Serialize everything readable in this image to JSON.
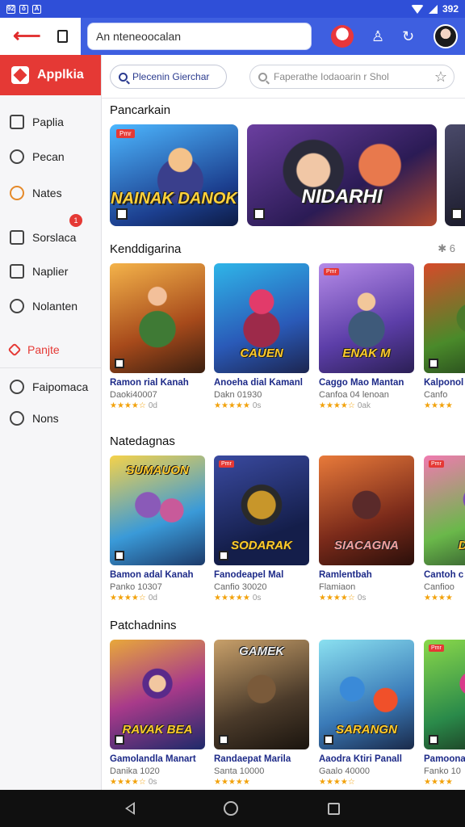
{
  "status": {
    "time": "392",
    "icons": [
      "92",
      "ō",
      "A"
    ]
  },
  "toolbar": {
    "address": "An nteneoocalan"
  },
  "sidebar": {
    "brand": "Applkia",
    "badge": "1",
    "items": [
      {
        "label": "Paplia",
        "icon": "document-icon"
      },
      {
        "label": "Pecan",
        "icon": "people-icon"
      },
      {
        "label": "Nates",
        "icon": "orange-circle-icon"
      },
      {
        "label": "Sorslaca",
        "icon": "list-icon"
      },
      {
        "label": "Naplier",
        "icon": "grid-icon"
      },
      {
        "label": "Nolanten",
        "icon": "clock-icon"
      },
      {
        "label": "Panjte",
        "icon": "diamond-icon",
        "active": true
      },
      {
        "label": "Faipomaca",
        "icon": "time-icon"
      },
      {
        "label": "Nons",
        "icon": "shield-icon"
      }
    ]
  },
  "filters": {
    "chip": "Plecenin Gierchar",
    "search_placeholder": "Faperathe Iodaoarin r Shol"
  },
  "sections": [
    {
      "title": "Pancarkain",
      "banners": [
        {
          "title": "NAINAK DANOK",
          "tag": "Pmr"
        },
        {
          "title": "NIDARHI",
          "tag": ""
        }
      ]
    },
    {
      "title": "Kenddigarina",
      "more": "✱ 6",
      "cards": [
        {
          "art": "",
          "title": "Ramon rial Kanah",
          "sub": "Daoki40007",
          "stars": "★★★★☆",
          "count": "0d"
        },
        {
          "art": "CAUEN",
          "title": "Anoeha dial Kamanl",
          "sub": "Dakn 01930",
          "stars": "★★★★★",
          "count": "0s"
        },
        {
          "art": "ENAK M",
          "title": "Caggo Mao Mantan",
          "sub": "Canfoa 04 lenoan",
          "stars": "★★★★☆",
          "count": "0ak"
        },
        {
          "art": "",
          "title": "Kalponol",
          "sub": "Canfo",
          "stars": "★★★★",
          "count": ""
        }
      ]
    },
    {
      "title": "Natedagnas",
      "cards": [
        {
          "art": "SUMAUON",
          "title": "Bamon adal Kanah",
          "sub": "Panko 10307",
          "stars": "★★★★☆",
          "count": "0d"
        },
        {
          "art": "SODARAK",
          "title": "Fanodeapel Mal",
          "sub": "Canfio 30020",
          "stars": "★★★★★",
          "count": "0s"
        },
        {
          "art": "SIACAGNA",
          "title": "Ramlentbah",
          "sub": "Flamiaon",
          "stars": "★★★★☆",
          "count": "0s"
        },
        {
          "art": "DNA",
          "title": "Cantoh c",
          "sub": "Canfioo",
          "stars": "★★★★",
          "count": ""
        }
      ]
    },
    {
      "title": "Patchadnins",
      "cards": [
        {
          "art": "RAVAK BEA",
          "title": "Gamolandla Manart",
          "sub": "Danika 1020",
          "stars": "★★★★☆",
          "count": "0s"
        },
        {
          "art": "GAMEK",
          "title": "Randaepat Marila",
          "sub": "Santa 10000",
          "stars": "★★★★★",
          "count": ""
        },
        {
          "art": "SARANGN",
          "title": "Aaodra Ktiri Panall",
          "sub": "Gaalo 40000",
          "stars": "★★★★☆",
          "count": ""
        },
        {
          "art": "",
          "title": "Pamoonadl",
          "sub": "Fanko 10",
          "stars": "★★★★",
          "count": ""
        }
      ]
    }
  ],
  "colors": {
    "accent": "#e53935",
    "toolbar": "#3e5fe0",
    "title_text": "#1d2a88"
  }
}
